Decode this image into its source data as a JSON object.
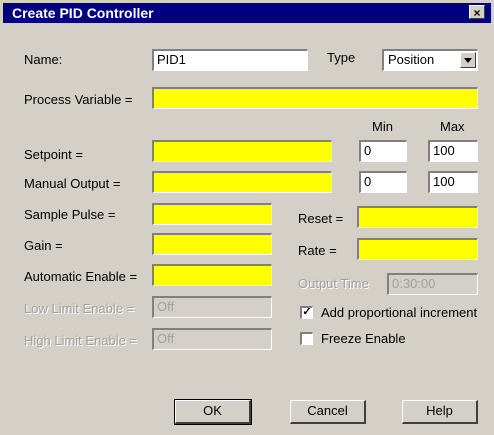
{
  "dialog": {
    "title": "Create PID Controller",
    "close_icon": "close-icon",
    "close_glyph": "×"
  },
  "name": {
    "label": "Name:",
    "value": "PID1"
  },
  "type": {
    "label": "Type",
    "selected": "Position"
  },
  "process_variable": {
    "label": "Process Variable =",
    "value": ""
  },
  "columns": {
    "min": "Min",
    "max": "Max"
  },
  "setpoint": {
    "label": "Setpoint =",
    "value": "",
    "min": "0",
    "max": "100"
  },
  "manual_output": {
    "label": "Manual Output =",
    "value": "",
    "min": "0",
    "max": "100"
  },
  "sample_pulse": {
    "label": "Sample Pulse =",
    "value": ""
  },
  "gain": {
    "label": "Gain =",
    "value": ""
  },
  "automatic_enable": {
    "label": "Automatic Enable =",
    "value": ""
  },
  "low_limit_enable": {
    "label": "Low Limit  Enable =",
    "value": "Off"
  },
  "high_limit_enable": {
    "label": "High Limit Enable =",
    "value": "Off"
  },
  "reset": {
    "label": "Reset =",
    "value": ""
  },
  "rate": {
    "label": "Rate =",
    "value": ""
  },
  "output_time": {
    "label": "Output Time",
    "value": "0:30:00"
  },
  "add_proportional": {
    "label": "Add proportional increment",
    "checked": true,
    "mark": "✓"
  },
  "freeze_enable": {
    "label": "Freeze Enable",
    "checked": false,
    "mark": ""
  },
  "buttons": {
    "ok": "OK",
    "cancel": "Cancel",
    "help": "Help"
  },
  "colors": {
    "title_bar": "#000080",
    "required_field": "#ffff00",
    "face": "#d4d0c8"
  }
}
